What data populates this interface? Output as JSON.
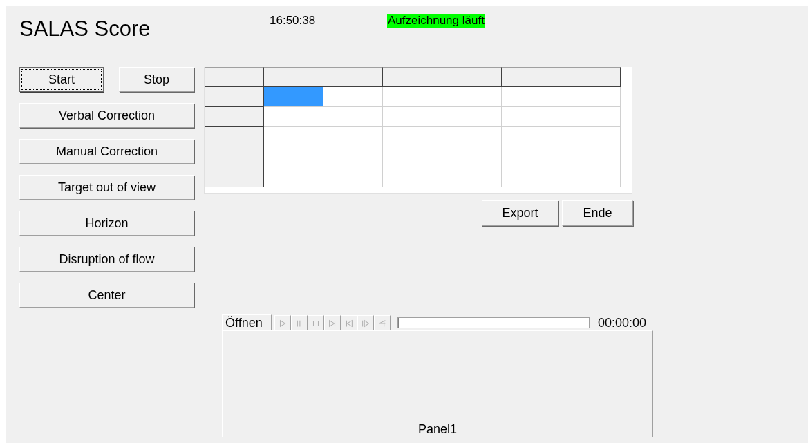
{
  "header": {
    "title": "SALAS Score",
    "clock": "16:50:38",
    "status": "Aufzeichnung läuft"
  },
  "buttons": [
    {
      "label": "Start",
      "focused": true
    },
    {
      "label": "Stop",
      "focused": false
    },
    {
      "label": "Verbal Correction",
      "focused": false
    },
    {
      "label": "Manual Correction",
      "focused": false
    },
    {
      "label": "Target out of view",
      "focused": false
    },
    {
      "label": "Horizon",
      "focused": false
    },
    {
      "label": "Disruption of flow",
      "focused": false
    },
    {
      "label": "Center",
      "focused": false
    }
  ],
  "table": {
    "columns": [
      {
        "kind": "fixed"
      },
      {
        "kind": "data"
      },
      {
        "kind": "data"
      },
      {
        "kind": "data"
      },
      {
        "kind": "data"
      },
      {
        "kind": "data"
      },
      {
        "kind": "data"
      }
    ],
    "rows": [
      {
        "cells": [
          {
            "selected": true
          },
          {
            "selected": false
          },
          {
            "selected": false
          },
          {
            "selected": false
          },
          {
            "selected": false
          },
          {
            "selected": false
          }
        ]
      },
      {
        "cells": [
          {
            "selected": false
          },
          {
            "selected": false
          },
          {
            "selected": false
          },
          {
            "selected": false
          },
          {
            "selected": false
          },
          {
            "selected": false
          }
        ]
      },
      {
        "cells": [
          {
            "selected": false
          },
          {
            "selected": false
          },
          {
            "selected": false
          },
          {
            "selected": false
          },
          {
            "selected": false
          },
          {
            "selected": false
          }
        ]
      },
      {
        "cells": [
          {
            "selected": false
          },
          {
            "selected": false
          },
          {
            "selected": false
          },
          {
            "selected": false
          },
          {
            "selected": false
          },
          {
            "selected": false
          }
        ]
      },
      {
        "cells": [
          {
            "selected": false
          },
          {
            "selected": false
          },
          {
            "selected": false
          },
          {
            "selected": false
          },
          {
            "selected": false
          },
          {
            "selected": false
          }
        ]
      }
    ]
  },
  "actions": [
    "Export",
    "Ende"
  ],
  "player": {
    "open_label": "Öffnen",
    "controls": [
      {
        "kind": "play",
        "disabled": true
      },
      {
        "kind": "pause",
        "disabled": true
      },
      {
        "kind": "stop",
        "disabled": true
      },
      {
        "kind": "next",
        "disabled": true
      },
      {
        "kind": "prev",
        "disabled": true
      },
      {
        "kind": "step",
        "disabled": true
      },
      {
        "kind": "back",
        "disabled": true
      }
    ],
    "position": {
      "level": 0
    },
    "time": "00:00:00",
    "panel_label": "Panel1"
  }
}
